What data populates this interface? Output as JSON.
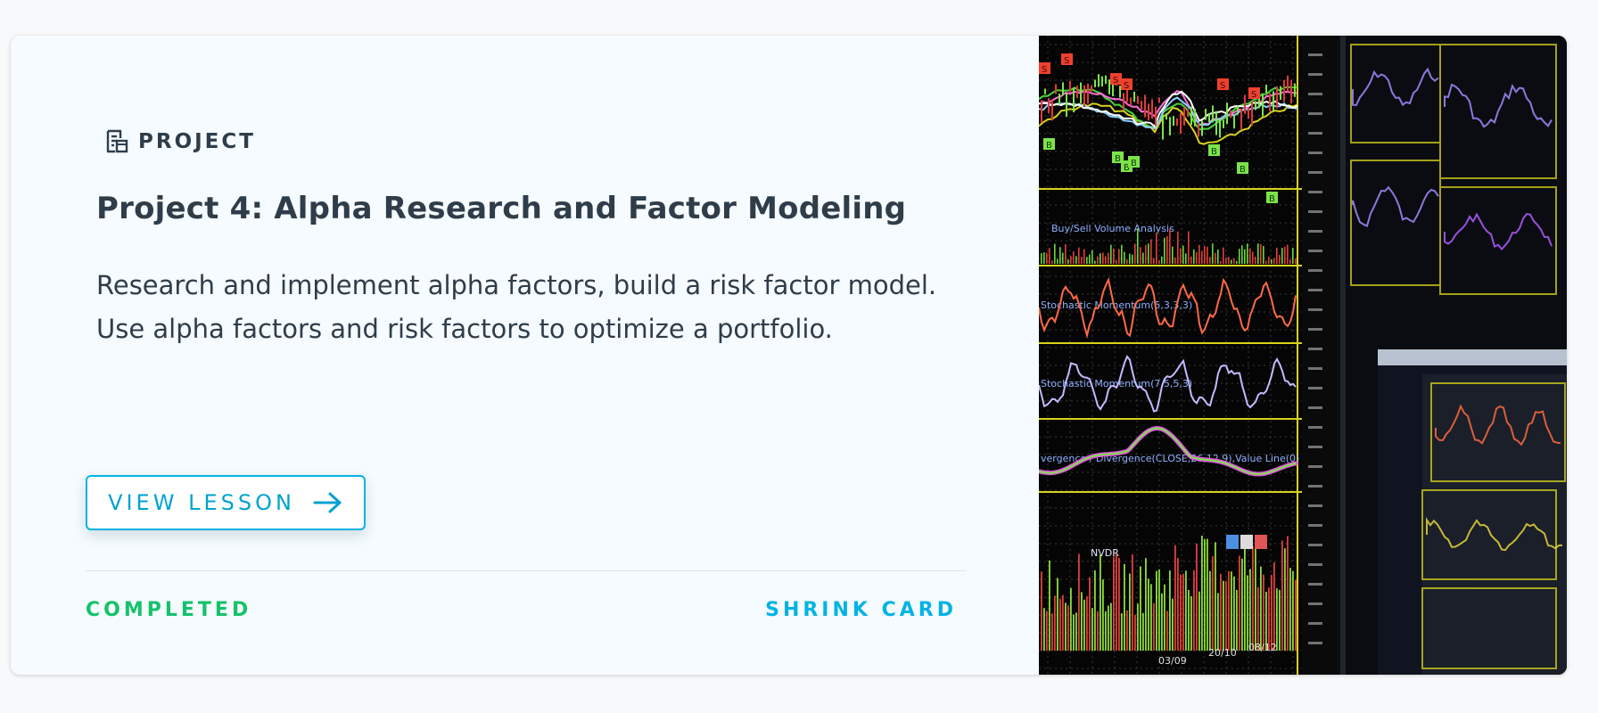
{
  "card": {
    "kind": "PROJECT",
    "kind_icon": "project-document-icon",
    "title": "Project 4: Alpha Research and Factor Modeling",
    "description_lines": [
      "Research and implement alpha factors, build a risk factor model.",
      "Use alpha factors and risk factors to optimize a portfolio."
    ],
    "view_button_label": "VIEW LESSON",
    "view_button_icon": "arrow-right-icon",
    "status": "COMPLETED",
    "shrink_label": "SHRINK CARD"
  },
  "image": {
    "description": "trading-charts-photo",
    "labels": {
      "volume": "Buy/Sell Volume Analysis",
      "stoch1": "Stochastic Momentum(5,3,3,3)",
      "stoch2": "Stochastic Momentum(7,5,5,3)",
      "macd": "vergence / Divergence(CLOSE,26,12,9),Value Line(0)",
      "nvdr": "NVDR",
      "dates": [
        "03/09",
        "20/10",
        "08/12"
      ]
    },
    "buy_markers": [
      "B",
      "B",
      "B",
      "B",
      "B",
      "B",
      "B"
    ],
    "sell_markers": [
      "S",
      "S",
      "S",
      "S",
      "S",
      "S"
    ]
  },
  "colors": {
    "accent": "#02b3e4",
    "text": "#2f3d4a",
    "completed": "#15c26b",
    "card_bg": "#f5fbfe",
    "page_bg": "#f7f9fb"
  }
}
